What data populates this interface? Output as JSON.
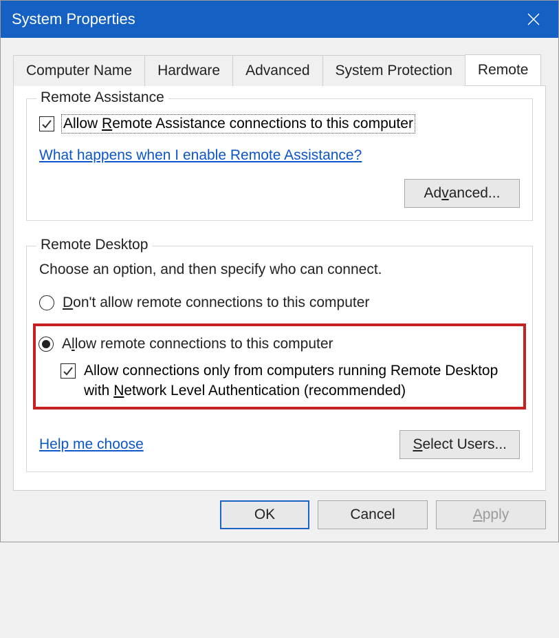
{
  "window": {
    "title": "System Properties",
    "close_icon_name": "close-icon"
  },
  "tabs": {
    "items": [
      {
        "label": "Computer Name"
      },
      {
        "label": "Hardware"
      },
      {
        "label": "Advanced"
      },
      {
        "label": "System Protection"
      },
      {
        "label": "Remote",
        "active": true
      }
    ]
  },
  "remote_assistance": {
    "group_title": "Remote Assistance",
    "allow_checkbox_label_before": "Allow ",
    "allow_checkbox_hotkey": "R",
    "allow_checkbox_label_after": "emote Assistance connections to this computer",
    "allow_checked": true,
    "help_link_text": "What happens when I enable Remote Assistance?",
    "advanced_btn_before": "Ad",
    "advanced_btn_hotkey": "v",
    "advanced_btn_after": "anced..."
  },
  "remote_desktop": {
    "group_title": "Remote Desktop",
    "intro_text": "Choose an option, and then specify who can connect.",
    "radio_dont_before": "",
    "radio_dont_hotkey": "D",
    "radio_dont_after": "on't allow remote connections to this computer",
    "radio_allow_before": "A",
    "radio_allow_hotkey": "l",
    "radio_allow_after": "low remote connections to this computer",
    "selected_option": "allow",
    "nla_checked": true,
    "nla_before": "Allow connections only from computers running Remote Desktop with ",
    "nla_hotkey": "N",
    "nla_after": "etwork Level Authentication (recommended)",
    "help_me_choose": "Help me choose",
    "select_users_before": "",
    "select_users_hotkey": "S",
    "select_users_after": "elect Users..."
  },
  "dialog_buttons": {
    "ok_label": "OK",
    "cancel_label": "Cancel",
    "apply_before": "",
    "apply_hotkey": "A",
    "apply_after": "pply",
    "apply_enabled": false
  }
}
